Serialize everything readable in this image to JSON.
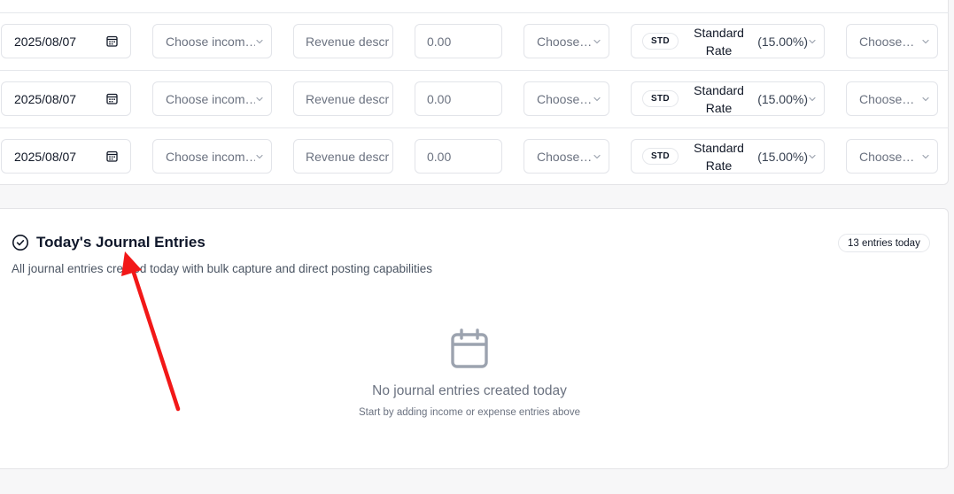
{
  "rows": [
    {
      "date": "2025/08/07",
      "income_placeholder": "Choose incom…",
      "description_placeholder": "Revenue descr",
      "amount_placeholder": "0.00",
      "choose1": "Choose…",
      "tax_badge": "STD",
      "tax_name": "Standard Rate",
      "tax_pct": "(15.00%)",
      "choose2": "Choose…"
    },
    {
      "date": "2025/08/07",
      "income_placeholder": "Choose incom…",
      "description_placeholder": "Revenue descr",
      "amount_placeholder": "0.00",
      "choose1": "Choose…",
      "tax_badge": "STD",
      "tax_name": "Standard Rate",
      "tax_pct": "(15.00%)",
      "choose2": "Choose…"
    },
    {
      "date": "2025/08/07",
      "income_placeholder": "Choose incom…",
      "description_placeholder": "Revenue descr",
      "amount_placeholder": "0.00",
      "choose1": "Choose…",
      "tax_badge": "STD",
      "tax_name": "Standard Rate",
      "tax_pct": "(15.00%)",
      "choose2": "Choose…"
    }
  ],
  "journal": {
    "title": "Today's Journal Entries",
    "subtitle": "All journal entries created today with bulk capture and direct posting capabilities",
    "count_badge": "13 entries today",
    "empty_title": "No journal entries created today",
    "empty_subtitle": "Start by adding income or expense entries above"
  },
  "colors": {
    "annotation_arrow": "#f21818"
  }
}
